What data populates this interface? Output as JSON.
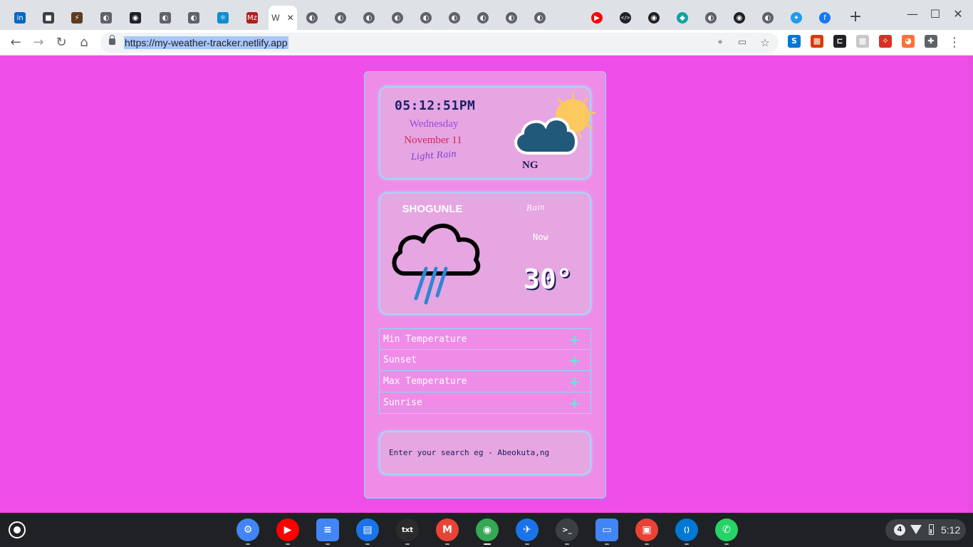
{
  "browser": {
    "url": "https://my-weather-tracker.netlify.app",
    "active_tab_title": "W",
    "tabs": [
      {
        "icon": "linkedin-icon",
        "glyph": "in",
        "color": "#0a66c2"
      },
      {
        "icon": "briefcase-icon",
        "glyph": "■",
        "color": "#3c4043"
      },
      {
        "icon": "lightning-icon",
        "glyph": "⚡",
        "color": "#5f3c1f"
      },
      {
        "icon": "globe-icon",
        "glyph": "◐",
        "color": "#5f6368"
      },
      {
        "icon": "github-icon",
        "glyph": "◉",
        "color": "#202124"
      },
      {
        "icon": "globe-icon",
        "glyph": "◐",
        "color": "#5f6368"
      },
      {
        "icon": "globe-icon",
        "glyph": "◐",
        "color": "#5f6368"
      },
      {
        "icon": "react-icon",
        "glyph": "⚛",
        "color": "#0d8ecf"
      },
      {
        "icon": "mz-icon",
        "glyph": "Mz",
        "color": "#b01e1e"
      }
    ],
    "tabs_right": [
      {
        "icon": "globe-icon",
        "glyph": "◐",
        "color": "#5f6368"
      },
      {
        "icon": "globe-icon",
        "glyph": "◐",
        "color": "#5f6368"
      },
      {
        "icon": "globe-icon",
        "glyph": "◐",
        "color": "#5f6368"
      },
      {
        "icon": "globe-icon",
        "glyph": "◐",
        "color": "#5f6368"
      },
      {
        "icon": "globe-icon",
        "glyph": "◐",
        "color": "#5f6368"
      },
      {
        "icon": "globe-icon",
        "glyph": "◐",
        "color": "#5f6368"
      },
      {
        "icon": "globe-icon",
        "glyph": "◐",
        "color": "#5f6368"
      },
      {
        "icon": "globe-icon",
        "glyph": "◐",
        "color": "#5f6368"
      },
      {
        "icon": "globe-icon",
        "glyph": "◐",
        "color": "#5f6368"
      },
      {
        "icon": "youtube-icon",
        "glyph": "▶",
        "color": "#ff0000"
      },
      {
        "icon": "code-icon",
        "glyph": "</>",
        "color": "#202124"
      },
      {
        "icon": "github-icon",
        "glyph": "◉",
        "color": "#202124"
      },
      {
        "icon": "diamond-icon",
        "glyph": "◆",
        "color": "#0fa3a3"
      },
      {
        "icon": "globe-icon",
        "glyph": "◐",
        "color": "#5f6368"
      },
      {
        "icon": "github-icon",
        "glyph": "◉",
        "color": "#202124"
      },
      {
        "icon": "globe-icon",
        "glyph": "◐",
        "color": "#5f6368"
      },
      {
        "icon": "twitter-icon",
        "glyph": "✦",
        "color": "#1d9bf0"
      },
      {
        "icon": "facebook-icon",
        "glyph": "f",
        "color": "#1877f2"
      }
    ],
    "extensions": [
      {
        "icon": "skype-icon",
        "glyph": "S",
        "color": "#0078d4"
      },
      {
        "icon": "office-icon",
        "glyph": "▦",
        "color": "#d83b01"
      },
      {
        "icon": "bracket-icon",
        "glyph": "⊏",
        "color": "#202124"
      },
      {
        "icon": "qr-icon",
        "glyph": "▩",
        "color": "#c8c8c8"
      },
      {
        "icon": "wand-icon",
        "glyph": "✧",
        "color": "#d93025"
      },
      {
        "icon": "firefox-icon",
        "glyph": "◕",
        "color": "#ff7139"
      },
      {
        "icon": "puzzle-icon",
        "glyph": "✚",
        "color": "#5f6368"
      }
    ]
  },
  "weather": {
    "clock": "05:12:51PM",
    "weekday": "Wednesday",
    "date": "November 11",
    "description": "Light Rain",
    "country": "NG",
    "city": "SHOGUNLE",
    "condition": "Rain",
    "now_label": "Now",
    "temperature": "30°",
    "details": [
      {
        "label": "Min Temperature",
        "toggle": "+"
      },
      {
        "label": "Sunset",
        "toggle": "+"
      },
      {
        "label": "Max Temperature",
        "toggle": "+"
      },
      {
        "label": "Sunrise",
        "toggle": "+"
      }
    ],
    "search_placeholder": "Enter your search eg - Abeokuta,ng"
  },
  "shelf": {
    "apps": [
      {
        "name": "settings-app-icon",
        "glyph": "⚙",
        "color": "#4285f4"
      },
      {
        "name": "youtube-app-icon",
        "glyph": "▶",
        "color": "#ff0000"
      },
      {
        "name": "docs-app-icon",
        "glyph": "≡",
        "color": "#4285f4"
      },
      {
        "name": "messages-app-icon",
        "glyph": "▤",
        "color": "#1a73e8"
      },
      {
        "name": "text-app-icon",
        "glyph": "txt",
        "color": "#2b2b2b"
      },
      {
        "name": "gmail-app-icon",
        "glyph": "M",
        "color": "#ea4335"
      },
      {
        "name": "chrome-app-icon",
        "glyph": "◉",
        "color": "#34a853"
      },
      {
        "name": "feedback-app-icon",
        "glyph": "✈",
        "color": "#1a73e8"
      },
      {
        "name": "terminal-app-icon",
        "glyph": ">_",
        "color": "#3c4043"
      },
      {
        "name": "files-app-icon",
        "glyph": "▭",
        "color": "#4285f4"
      },
      {
        "name": "video-app-icon",
        "glyph": "▣",
        "color": "#ea4335"
      },
      {
        "name": "vscode-app-icon",
        "glyph": "⟨⟩",
        "color": "#0078d4"
      },
      {
        "name": "whatsapp-app-icon",
        "glyph": "✆",
        "color": "#25d366"
      }
    ],
    "notification_count": "4",
    "time": "5:12"
  }
}
